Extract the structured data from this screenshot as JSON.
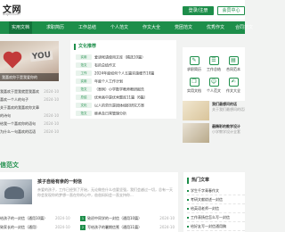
{
  "header": {
    "logo_title": "文网",
    "logo_sub": "anjiu.com",
    "login_label": "登录/注册",
    "member_label": "会员中心"
  },
  "nav": [
    "实用文档",
    "求职简历",
    "工作总结",
    "个人范文",
    "作文大全",
    "党团范文",
    "优秀作文",
    "合同范文",
    "教学设计"
  ],
  "banner_caption": "我喜欢你于是我爱你的",
  "left_list": [
    {
      "text": "喜欢你于是我爱你的",
      "date": ""
    },
    {
      "text": "我喜欢于是我就是我喜欢",
      "date": "2024-10"
    },
    {
      "text": "喜欢一个人的句子",
      "date": "2024-10"
    },
    {
      "text": "关于喜欢的我喜欢你文章",
      "date": ""
    },
    {
      "text": "的诗句",
      "date": "2024-10"
    },
    {
      "text": "给我一个喜欢你的语句",
      "date": "2024-10"
    },
    {
      "text": "为什么一句喜欢的话语",
      "date": "2024-10"
    }
  ],
  "center": {
    "title": "文化推荐",
    "items": [
      {
        "tag": "实用",
        "text": "爱读帐请使用文库（精选10篇）"
      },
      {
        "tag": "范文",
        "text": "有的总结作文"
      },
      {
        "tag": "工作",
        "text": "2024年度如何个人五篇实施细节10篇"
      },
      {
        "tag": "实用",
        "text": "年度个人工作计划"
      },
      {
        "tag": "范文",
        "text": "（案例）小学数学教师教研报告"
      },
      {
        "tag": "总结",
        "text": "优秀高中是优秀题库11篇（6篇）"
      },
      {
        "tag": "文化",
        "text": "以人的劳乐是团体组织研究方案"
      },
      {
        "tag": "范文",
        "text": "继承及日常管理分析"
      },
      {
        "tag": "实用",
        "text": "适合年上高中年活动方案10篇"
      }
    ]
  },
  "quick": [
    "求职简历",
    "工作总结",
    "合同范本",
    "实用文档",
    "个人范文",
    "作文大全"
  ],
  "side": [
    {
      "title": "我们最想问的话",
      "desc": "关于我们最想问的话说"
    },
    {
      "title": "最精彩的教学设计",
      "desc": "小学教学设计全套"
    }
  ],
  "section2": {
    "title": "信范文",
    "feature_title": "孩子自给有亲的一封信",
    "feature_desc": "亲爱的孩子，工作已经到了开始，无论做些什么也要坚强，我们会越过一切，总有一天你会发现你的梦想一直在你的心中，爸爸妈妈会一直支持你...",
    "left_items": [
      {
        "text": "给孩子的一封信（通用10篇）",
        "date": "2024-10"
      },
      {
        "text": "致家长的一封信（通用）",
        "date": "2024-10"
      }
    ],
    "right_items": [
      {
        "num": "1",
        "text": "致初中同学的一封信（通用10篇）",
        "date": "2024-10"
      },
      {
        "num": "2",
        "text": "写给孩子的暑期信笺（通用11篇）",
        "date": "2024-10"
      }
    ]
  },
  "hot": {
    "title": "热门文章",
    "items": [
      "学生千字青春作文",
      "考研文献综述一封信",
      "给英语老师一封信",
      "工作表扬信怎么写一封信",
      "给好友写一封信通用稿"
    ]
  },
  "colors": {
    "accent": "#1d8e4a"
  }
}
